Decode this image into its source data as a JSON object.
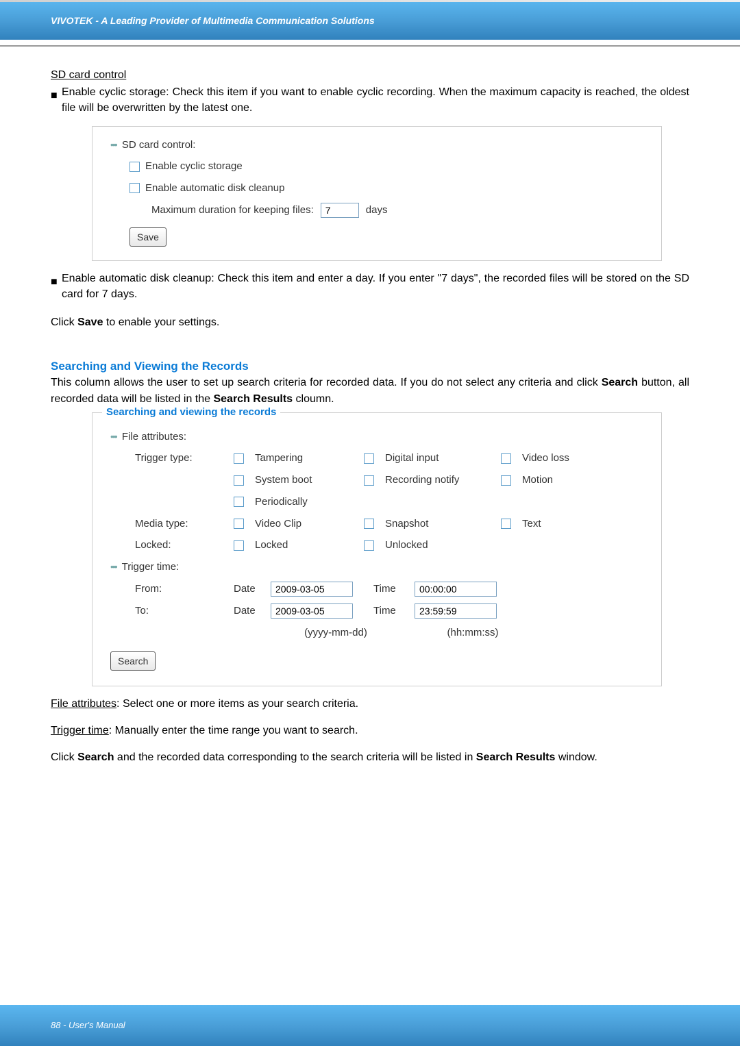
{
  "header": {
    "title": "VIVOTEK - A Leading Provider of Multimedia Communication Solutions"
  },
  "sd_card": {
    "section_title": "SD card control",
    "bullet1": "Enable cyclic storage: Check this item if you want to enable cyclic recording. When the maximum capacity is reached, the oldest file will be overwritten by the latest one.",
    "panel_title": "SD card control:",
    "cb_cyclic": "Enable cyclic storage",
    "cb_cleanup": "Enable automatic disk cleanup",
    "max_label": "Maximum duration for keeping files:",
    "max_value": "7",
    "days": "days",
    "save": "Save",
    "bullet2": "Enable automatic disk cleanup: Check this item and enter a day. If you enter \"7 days\", the recorded files will be stored on the SD card for 7 days.",
    "click_save": "Click Save to enable your settings.",
    "click_save_pre": "Click ",
    "click_save_b": "Save",
    "click_save_post": " to enable your settings."
  },
  "search": {
    "heading": "Searching and Viewing the Records",
    "intro_pre": "This column allows the user to set up search criteria for recorded data. If you do not select any criteria and click ",
    "intro_b1": "Search",
    "intro_mid": " button, all recorded data will be listed in the ",
    "intro_b2": "Search Results",
    "intro_post": " cloumn.",
    "legend": "Searching and viewing the records",
    "file_attr": "File attributes:",
    "trigger_type": "Trigger type:",
    "tampering": "Tampering",
    "digital_input": "Digital input",
    "video_loss": "Video loss",
    "system_boot": "System boot",
    "recording_notify": "Recording notify",
    "motion": "Motion",
    "periodically": "Periodically",
    "media_type": "Media type:",
    "video_clip": "Video Clip",
    "snapshot": "Snapshot",
    "text": "Text",
    "locked_lbl": "Locked:",
    "locked": "Locked",
    "unlocked": "Unlocked",
    "trigger_time": "Trigger time:",
    "from": "From:",
    "to": "To:",
    "date": "Date",
    "time": "Time",
    "from_date": "2009-03-05",
    "from_time": "00:00:00",
    "to_date": "2009-03-05",
    "to_time": "23:59:59",
    "date_hint": "(yyyy-mm-dd)",
    "time_hint": "(hh:mm:ss)",
    "search_btn": "Search"
  },
  "post": {
    "file_attr_u": "File attributes",
    "file_attr_t": ": Select one or more items as your search criteria.",
    "trig_u": "Trigger time",
    "trig_t": ": Manually enter the time range you want to search.",
    "click_pre": "Click ",
    "click_b1": "Search",
    "click_mid": " and the recorded data corresponding to the search criteria will be listed in ",
    "click_b2": "Search Results",
    "click_post": " window."
  },
  "footer": {
    "text": "88 - User's Manual"
  }
}
